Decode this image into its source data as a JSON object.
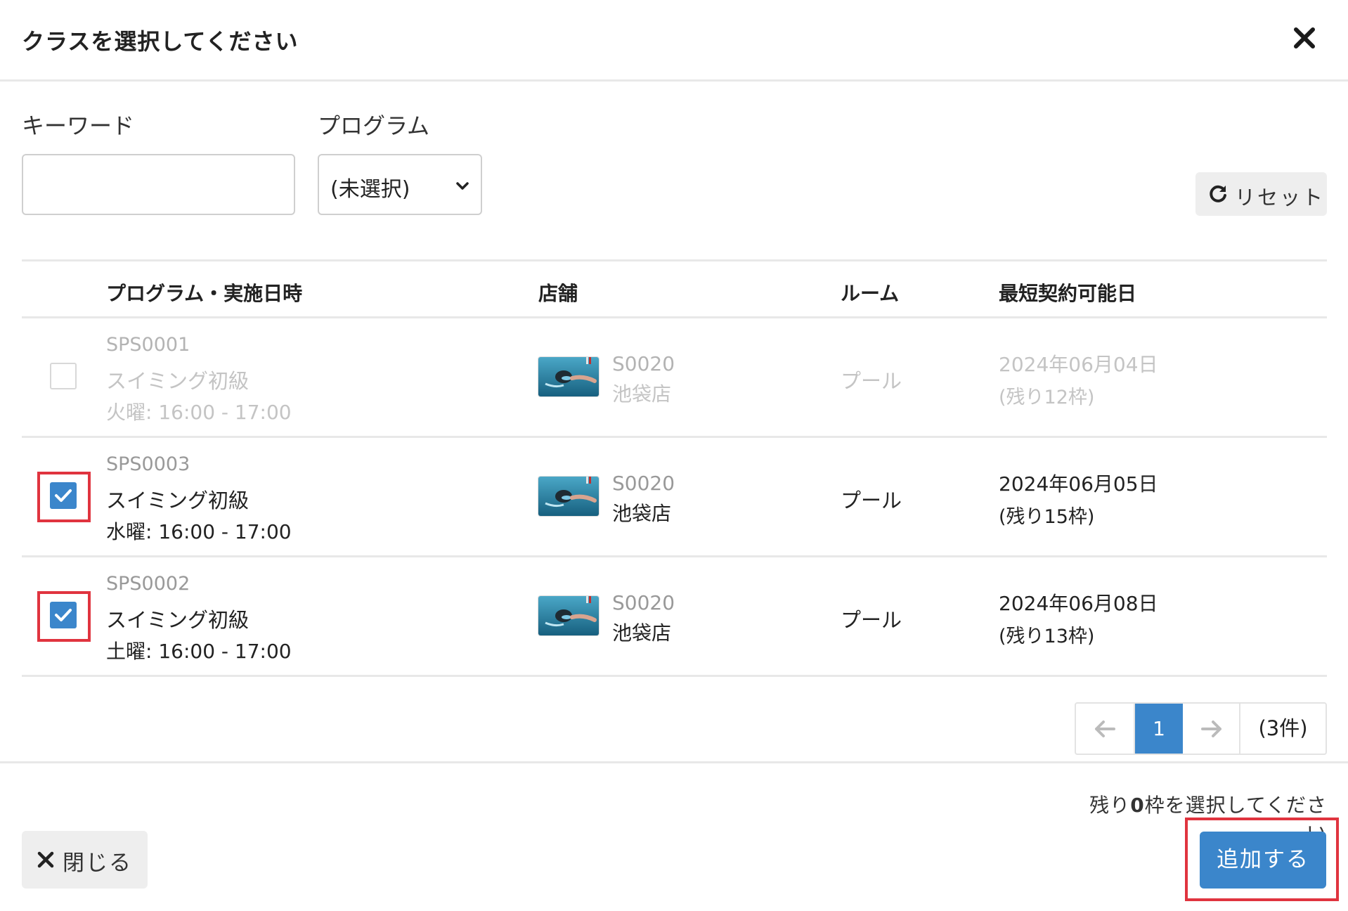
{
  "modal": {
    "title": "クラスを選択してください"
  },
  "filters": {
    "keyword_label": "キーワード",
    "keyword_value": "",
    "program_label": "プログラム",
    "program_selected": "(未選択)",
    "reset_label": "リセット"
  },
  "table": {
    "columns": [
      "プログラム・実施日時",
      "店舗",
      "ルーム",
      "最短契約可能日"
    ],
    "rows": [
      {
        "checked": false,
        "disabled": true,
        "code": "SPS0001",
        "program": "スイミング初級",
        "schedule": "火曜: 16:00 - 17:00",
        "store_code": "S0020",
        "store_name": "池袋店",
        "room": "プール",
        "earliest_date": "2024年06月04日",
        "remaining": "(残り12枠)"
      },
      {
        "checked": true,
        "disabled": false,
        "code": "SPS0003",
        "program": "スイミング初級",
        "schedule": "水曜: 16:00 - 17:00",
        "store_code": "S0020",
        "store_name": "池袋店",
        "room": "プール",
        "earliest_date": "2024年06月05日",
        "remaining": "(残り15枠)"
      },
      {
        "checked": true,
        "disabled": false,
        "code": "SPS0002",
        "program": "スイミング初級",
        "schedule": "土曜: 16:00 - 17:00",
        "store_code": "S0020",
        "store_name": "池袋店",
        "room": "プール",
        "earliest_date": "2024年06月08日",
        "remaining": "(残り13枠)"
      }
    ]
  },
  "pagination": {
    "current_page": "1",
    "count_label": "(3件)"
  },
  "footer": {
    "note_prefix": "残り",
    "note_count": "0",
    "note_suffix": "枠を選択してください",
    "close_label": "閉じる",
    "add_label": "追加する"
  },
  "colors": {
    "accent": "#3b86cb",
    "highlight": "#e0343f",
    "disabled_text": "#c4c4c4"
  },
  "icons": {
    "close": "close-icon",
    "chevron": "chevron-down-icon",
    "reset": "refresh-icon",
    "prev": "arrow-left-icon",
    "next": "arrow-right-icon",
    "check": "check-icon",
    "thumbnail": "store-thumbnail"
  }
}
